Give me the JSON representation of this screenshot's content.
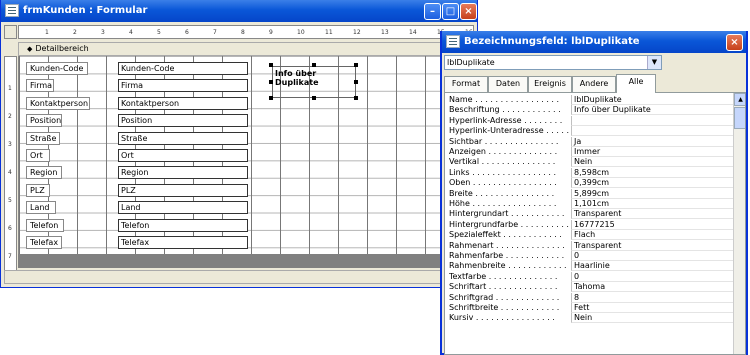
{
  "form_window": {
    "title": "frmKunden : Formular",
    "section_label": "Detailbereich",
    "ruler_h": [
      "1",
      "2",
      "3",
      "4",
      "5",
      "6",
      "7",
      "8",
      "9",
      "10",
      "11",
      "12",
      "13",
      "14",
      "15",
      "16"
    ],
    "ruler_v": [
      "1",
      "2",
      "3",
      "4",
      "5",
      "6",
      "7"
    ],
    "fields": [
      {
        "label": "Kunden-Code",
        "value": "Kunden-Code"
      },
      {
        "label": "Firma",
        "value": "Firma"
      },
      {
        "label": "Kontaktperson",
        "value": "Kontaktperson"
      },
      {
        "label": "Position",
        "value": "Position"
      },
      {
        "label": "Straße",
        "value": "Straße"
      },
      {
        "label": "Ort",
        "value": "Ort"
      },
      {
        "label": "Region",
        "value": "Region"
      },
      {
        "label": "PLZ",
        "value": "PLZ"
      },
      {
        "label": "Land",
        "value": "Land"
      },
      {
        "label": "Telefon",
        "value": "Telefon"
      },
      {
        "label": "Telefax",
        "value": "Telefax"
      }
    ],
    "dup_label": "Info über Duplikate"
  },
  "prop_window": {
    "title": "Bezeichnungsfeld: lblDuplikate",
    "selected_object": "lblDuplikate",
    "tabs": [
      "Format",
      "Daten",
      "Ereignis",
      "Andere",
      "Alle"
    ],
    "active_tab": "Alle",
    "properties": [
      {
        "name": "Name . . . . . . . . . . . . . . . . .",
        "value": "lblDuplikate"
      },
      {
        "name": "Beschriftung . . . . . . . . . . . .",
        "value": "Info über Duplikate"
      },
      {
        "name": "Hyperlink-Adresse . . . . . . . .",
        "value": ""
      },
      {
        "name": "Hyperlink-Unteradresse . . . . .",
        "value": ""
      },
      {
        "name": "Sichtbar . . . . . . . . . . . . . . .",
        "value": "Ja"
      },
      {
        "name": "Anzeigen . . . . . . . . . . . . . .",
        "value": "Immer"
      },
      {
        "name": "Vertikal . . . . . . . . . . . . . . .",
        "value": "Nein"
      },
      {
        "name": "Links . . . . . . . . . . . . . . . . .",
        "value": "8,598cm"
      },
      {
        "name": "Oben . . . . . . . . . . . . . . . . .",
        "value": "0,399cm"
      },
      {
        "name": "Breite . . . . . . . . . . . . . . . .",
        "value": "5,899cm"
      },
      {
        "name": "Höhe . . . . . . . . . . . . . . . . .",
        "value": "1,101cm"
      },
      {
        "name": "Hintergrundart . . . . . . . . . . .",
        "value": "Transparent"
      },
      {
        "name": "Hintergrundfarbe . . . . . . . . . .",
        "value": "16777215"
      },
      {
        "name": "Spezialeffekt . . . . . . . . . . . .",
        "value": "Flach"
      },
      {
        "name": "Rahmenart . . . . . . . . . . . . . .",
        "value": "Transparent"
      },
      {
        "name": "Rahmenfarbe . . . . . . . . . . . .",
        "value": "0"
      },
      {
        "name": "Rahmenbreite . . . . . . . . . . . .",
        "value": "Haarlinie"
      },
      {
        "name": "Textfarbe . . . . . . . . . . . . . .",
        "value": "0"
      },
      {
        "name": "Schriftart . . . . . . . . . . . . . .",
        "value": "Tahoma"
      },
      {
        "name": "Schriftgrad . . . . . . . . . . . . .",
        "value": "8"
      },
      {
        "name": "Schriftbreite . . . . . . . . . . . .",
        "value": "Fett"
      },
      {
        "name": "Kursiv . . . . . . . . . . . . . . . .",
        "value": "Nein"
      }
    ]
  }
}
